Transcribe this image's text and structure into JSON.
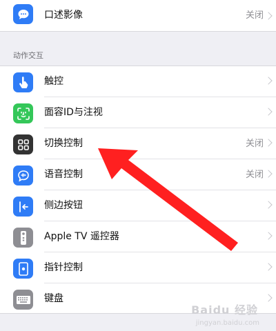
{
  "top_group": {
    "items": [
      {
        "label": "口述影像",
        "value": "关闭",
        "icon": "speech-bubble-icon",
        "color": "#2f7cf6"
      }
    ]
  },
  "section": {
    "header": "动作交互",
    "items": [
      {
        "label": "触控",
        "value": "",
        "icon": "hand-touch-icon",
        "color": "#2f7cf6"
      },
      {
        "label": "面容ID与注视",
        "value": "",
        "icon": "face-id-icon",
        "color": "#34c759"
      },
      {
        "label": "切换控制",
        "value": "关闭",
        "icon": "grid-icon",
        "color": "#333333"
      },
      {
        "label": "语音控制",
        "value": "关闭",
        "icon": "voice-control-icon",
        "color": "#2f7cf6"
      },
      {
        "label": "侧边按钮",
        "value": "",
        "icon": "side-button-icon",
        "color": "#2f7cf6"
      },
      {
        "label": "Apple TV 遥控器",
        "value": "",
        "icon": "remote-icon",
        "color": "#8e8e93"
      },
      {
        "label": "指针控制",
        "value": "",
        "icon": "pointer-icon",
        "color": "#2f7cf6"
      },
      {
        "label": "键盘",
        "value": "",
        "icon": "keyboard-icon",
        "color": "#8e8e93"
      }
    ]
  },
  "annotation": {
    "color": "#ff2020",
    "target": "切换控制"
  },
  "watermark": {
    "brand": "Baidu 经验",
    "url": "jingyan.baidu.com"
  }
}
